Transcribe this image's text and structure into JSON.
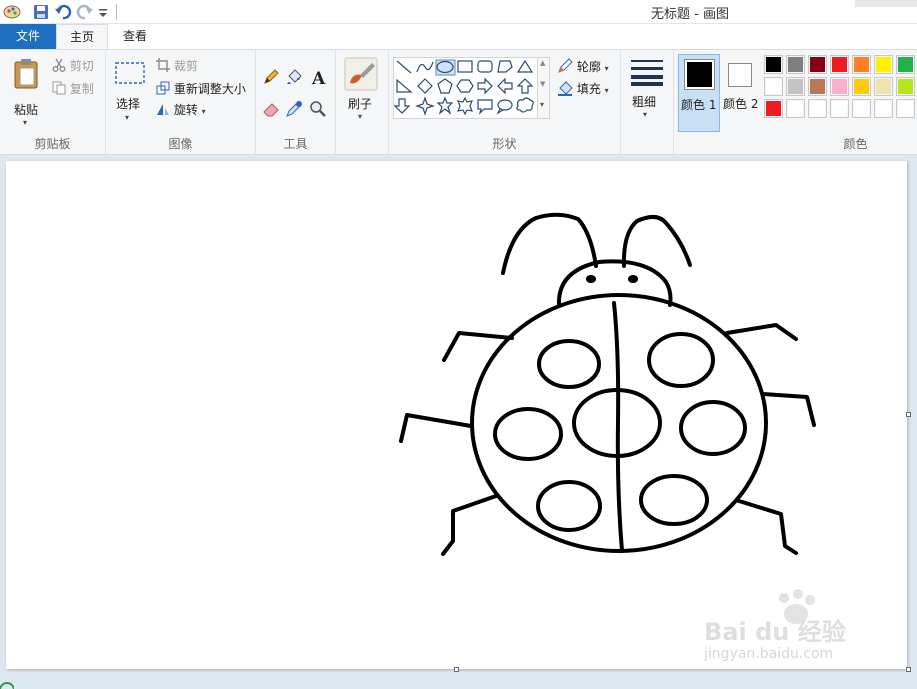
{
  "window": {
    "title": "无标题 - 画图"
  },
  "tabs": {
    "file": "文件",
    "home": "主页",
    "view": "查看"
  },
  "clipboard": {
    "paste": "粘贴",
    "cut": "剪切",
    "copy": "复制",
    "label": "剪贴板"
  },
  "image": {
    "select": "选择",
    "crop": "裁剪",
    "resize": "重新调整大小",
    "rotate": "旋转",
    "label": "图像"
  },
  "tools": {
    "label": "工具"
  },
  "brushes": {
    "label": "刷子"
  },
  "shapes": {
    "outline": "轮廓",
    "fill": "填充",
    "label": "形状"
  },
  "size": {
    "label": "粗细"
  },
  "colors": {
    "color1_label": "颜色 1",
    "color2_label": "颜色 2",
    "label": "颜色",
    "color1": "#000000",
    "color2": "#ffffff",
    "palette": [
      "#000000",
      "#7f7f7f",
      "#880015",
      "#ed1c24",
      "#ff7f27",
      "#fff200",
      "#22b14c",
      "#ffffff",
      "#c3c3c3",
      "#b97a57",
      "#ffaec9",
      "#ffc90e",
      "#efe4b0",
      "#b5e61d",
      "#ed1c24",
      "#ffffff",
      "#ffffff",
      "#ffffff",
      "#ffffff",
      "#ffffff",
      "#ffffff"
    ]
  },
  "watermark": {
    "logo": "Bai du 经验",
    "url": "jingyan.baidu.com"
  }
}
